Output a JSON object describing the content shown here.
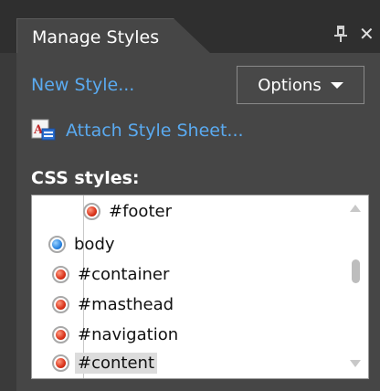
{
  "panel": {
    "tab_title": "Manage Styles",
    "pin_icon": "pin-icon",
    "close_icon": "close-icon"
  },
  "toolbar": {
    "new_style": "New Style...",
    "options_label": "Options",
    "attach_label": "Attach Style Sheet...",
    "attach_icon": "attach-stylesheet-icon"
  },
  "styles_list": {
    "label": "CSS styles:",
    "items": [
      {
        "label": "#footer",
        "type": "id-selector",
        "bullet_color": "#d8321a"
      },
      {
        "label": "body",
        "type": "element-selector",
        "bullet_color": "#2a84e0"
      },
      {
        "label": "#container",
        "type": "id-selector",
        "bullet_color": "#d8321a"
      },
      {
        "label": "#masthead",
        "type": "id-selector",
        "bullet_color": "#d8321a"
      },
      {
        "label": "#navigation",
        "type": "id-selector",
        "bullet_color": "#d8321a"
      },
      {
        "label": "#content",
        "type": "id-selector",
        "bullet_color": "#d8321a",
        "selected": true
      }
    ]
  },
  "colors": {
    "link": "#5aaaf0",
    "panel_bg": "#464646",
    "list_bg": "#ffffff"
  }
}
